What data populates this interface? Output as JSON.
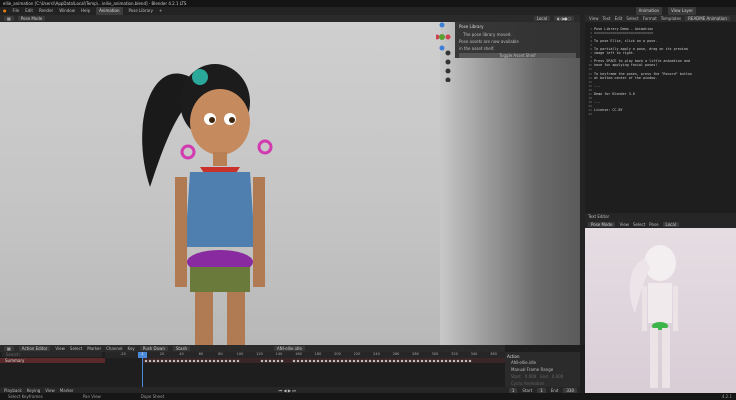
{
  "window": {
    "title": "ellie_animation [C:\\Users\\\\AppData\\Local\\Temp\\...\\ellie_animation.blend] - Blender 4.2.1 LTS"
  },
  "menubar": {
    "items": [
      "File",
      "Edit",
      "Render",
      "Window",
      "Help"
    ],
    "workspaces": [
      "Animation",
      "Pose Library"
    ],
    "add": "+",
    "scene": "Animation",
    "view_layer": "View Layer"
  },
  "viewport": {
    "mode": "Pose Mode",
    "orientation": "Local"
  },
  "pose_panel": {
    "title": "Pose Library",
    "line1": "The pose library moved.",
    "line2": "Pose assets are now available",
    "line3": "in the asset shelf.",
    "button": "Toggle Asset Shelf"
  },
  "text_editor": {
    "menus": [
      "View",
      "Text",
      "Edit",
      "Select",
      "Format",
      "Templates"
    ],
    "filename": "README Animation",
    "lines": [
      "Pose Library Demo - Animation",
      "=============================",
      "",
      "To pose Ellie, click on a pose.",
      "",
      "To partially apply a pose, drag on its preview",
      "image left to right.",
      "",
      "Press SPACE to play back a little animation and",
      "have fun applying facial poses!",
      "",
      "To keyframe the poses, press the \"Record\" button",
      "at bottom center of the window.",
      "",
      "---",
      "",
      "Demo for Blender 3.0",
      "",
      "---",
      "",
      "License: CC-BY",
      ""
    ]
  },
  "text_editor2": {
    "title": "Text Editor",
    "mode": "Pose Mode",
    "menus": [
      "View",
      "Select",
      "Pose"
    ],
    "orientation": "Local"
  },
  "timeline": {
    "editor": "Action Editor",
    "menus": [
      "View",
      "Select",
      "Marker",
      "Channel",
      "Key"
    ],
    "push_down": "Push Down",
    "stash": "Stash",
    "action": "ANI-ellie.idle",
    "summary": "Summary",
    "search_placeholder": "Search",
    "current_frame": "1",
    "ticks": [
      "-20",
      "1",
      "20",
      "40",
      "60",
      "80",
      "100",
      "120",
      "140",
      "160",
      "180",
      "200",
      "220",
      "240",
      "260",
      "280",
      "300",
      "320",
      "340",
      "360"
    ],
    "playback": [
      "Playback",
      "Keying",
      "View",
      "Marker"
    ],
    "frame": "1",
    "start_label": "Start",
    "start": "1",
    "end_label": "End",
    "end": "330"
  },
  "action_panel": {
    "title": "Action",
    "name": "ANI-ellie.idle",
    "manual_range": "Manual Frame Range",
    "start_label": "Start",
    "start": "0.000",
    "end_label": "End",
    "end": "0.000",
    "cyclic": "Cyclic Animation"
  },
  "status": [
    "Select Keyframes",
    "Pan View",
    "Dope Sheet"
  ],
  "version": "4.2.1"
}
